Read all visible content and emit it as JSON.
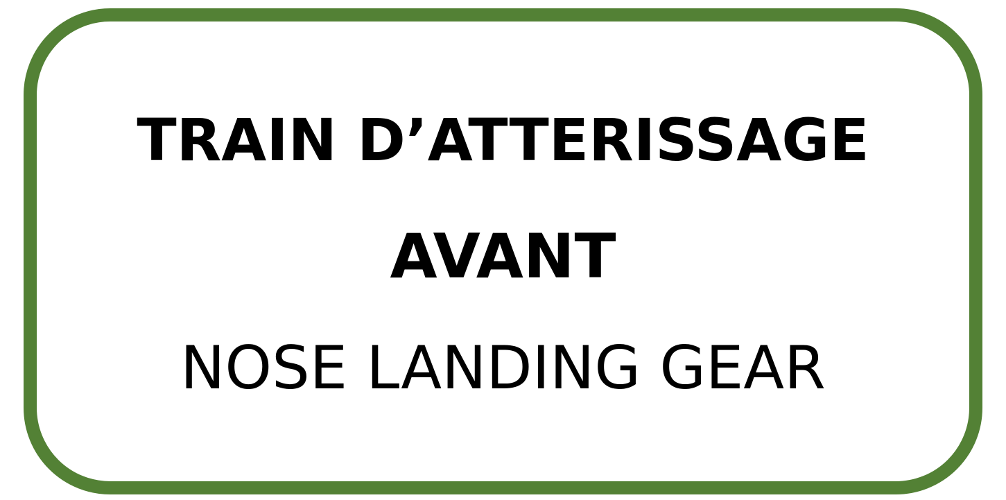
{
  "sign": {
    "border_color": "#538135",
    "background_color": "#ffffff",
    "text_color": "#000000",
    "line_1": "TRAIN D’ATTERISSAGE",
    "line_2": "AVANT",
    "line_3": "NOSE LANDING GEAR"
  }
}
